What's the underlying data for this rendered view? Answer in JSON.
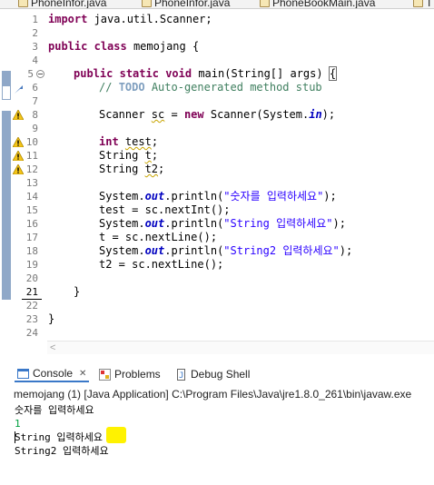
{
  "editor_tabs": [
    {
      "label": "PhoneInfor.java"
    },
    {
      "label": "PhoneInfor.java"
    },
    {
      "label": "PhoneBookMain.java"
    },
    {
      "label": "T"
    }
  ],
  "editor": {
    "line_numbers": [
      "1",
      "2",
      "3",
      "4",
      "5",
      "6",
      "7",
      "8",
      "9",
      "10",
      "11",
      "12",
      "13",
      "14",
      "15",
      "16",
      "17",
      "18",
      "19",
      "20",
      "21",
      "22",
      "23",
      "24"
    ],
    "code": {
      "l1_kw": "import",
      "l1_rest": " java.util.Scanner;",
      "l3_kw1": "public",
      "l3_kw2": "class",
      "l3_rest": " memojang {",
      "l5_kw1": "public",
      "l5_kw2": "static",
      "l5_kw3": "void",
      "l5_rest": " main(String[] args) ",
      "l5_brace": "{",
      "l6_comment_pre": "// ",
      "l6_todo": "TODO",
      "l6_comment_rest": " Auto-generated method stub",
      "l8_pre": "Scanner ",
      "l8_var": "sc",
      "l8_mid": " = ",
      "l8_kw": "new",
      "l8_mid2": " Scanner(System.",
      "l8_field": "in",
      "l8_end": ");",
      "l10_kw": "int",
      "l10_var": "test",
      "l10_end": ";",
      "l11_pre": "String ",
      "l11_var": "t",
      "l11_end": ";",
      "l12_pre": "String ",
      "l12_var": "t2",
      "l12_end": ";",
      "l14_pre": "System.",
      "l14_field": "out",
      "l14_mid": ".println(",
      "l14_str": "\"숫자를 입력하세요\"",
      "l14_end": ");",
      "l15": "test = sc.nextInt();",
      "l16_pre": "System.",
      "l16_field": "out",
      "l16_mid": ".println(",
      "l16_str": "\"String 입력하세요\"",
      "l16_end": ");",
      "l17": "t = sc.nextLine();",
      "l18_pre": "System.",
      "l18_field": "out",
      "l18_mid": ".println(",
      "l18_str": "\"String2 입력하세요\"",
      "l18_end": ");",
      "l19": "t2 = sc.nextLine();",
      "l21": "}",
      "l23": "}"
    }
  },
  "panel": {
    "tabs": [
      {
        "label": "Console",
        "close": "✕",
        "icon": "console-icon"
      },
      {
        "label": "Problems",
        "icon": "problems-icon"
      },
      {
        "label": "Debug Shell",
        "icon": "debug-shell-icon"
      }
    ],
    "console_header": "memojang (1) [Java Application] C:\\Program Files\\Java\\jre1.8.0_261\\bin\\javaw.exe",
    "console_lines": [
      {
        "text": "숫자를 입력하세요",
        "type": "output"
      },
      {
        "text": "1",
        "type": "input"
      },
      {
        "text": "String 입력하세요",
        "type": "output"
      },
      {
        "text": "String2 입력하세요",
        "type": "output"
      }
    ]
  },
  "colors": {
    "keyword": "#7f0055",
    "comment": "#3f7f5f",
    "string": "#2a00ff",
    "field": "#0000c0",
    "console_input": "#00a040",
    "highlight": "#fff200",
    "ruler_marker": "#8fa8c8"
  }
}
